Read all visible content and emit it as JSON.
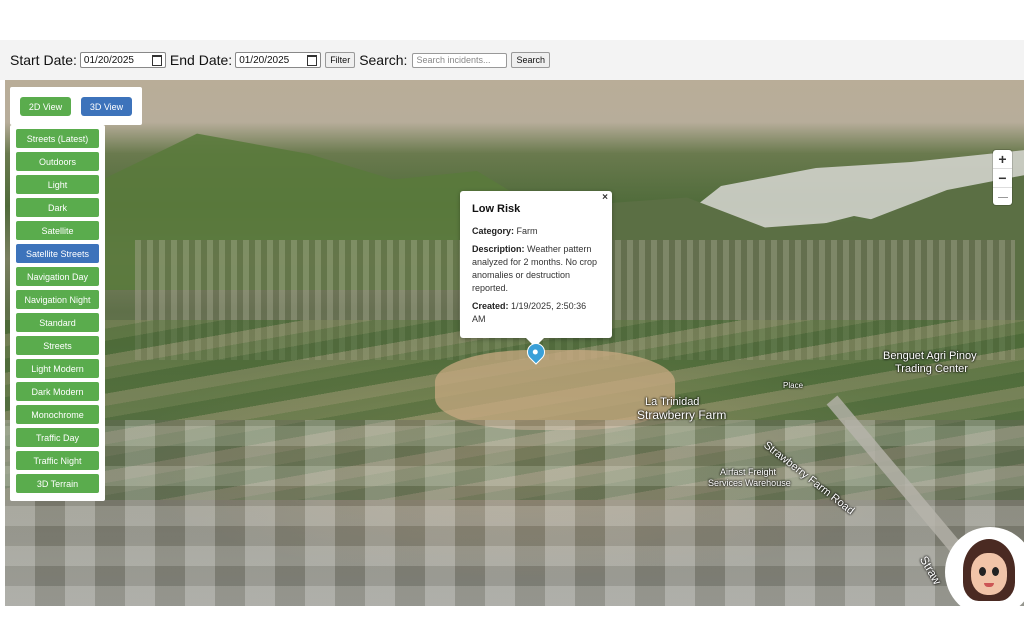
{
  "filters": {
    "start_date_label": "Start Date:",
    "start_date_value": "01/20/2025",
    "end_date_label": "End Date:",
    "end_date_value": "01/20/2025",
    "filter_button": "Filter",
    "search_label": "Search:",
    "search_placeholder": "Search incidents...",
    "search_button": "Search"
  },
  "views": {
    "btn_2d": "2D View",
    "btn_3d": "3D View",
    "colors": {
      "green": "#5aac4d",
      "blue": "#3d73bb"
    }
  },
  "map_styles": [
    "Streets (Latest)",
    "Outdoors",
    "Light",
    "Dark",
    "Satellite",
    "Satellite Streets",
    "Navigation Day",
    "Navigation Night",
    "Standard",
    "Streets",
    "Light Modern",
    "Dark Modern",
    "Monochrome",
    "Traffic Day",
    "Traffic Night",
    "3D Terrain"
  ],
  "active_style": "Satellite Streets",
  "zoom": {
    "in": "+",
    "out": "−"
  },
  "popup": {
    "close": "×",
    "title": "Low Risk",
    "category_label": "Category:",
    "category_value": "Farm",
    "description_label": "Description:",
    "description_value": "Weather pattern analyzed for 2 months. No crop anomalies or destruction reported.",
    "created_label": "Created:",
    "created_value": "1/19/2025, 2:50:36 AM"
  },
  "map_labels": {
    "la_trinidad": "La Trinidad",
    "strawberry_farm": "Strawberry Farm",
    "benguet_agri_1": "Benguet Agri Pinoy",
    "benguet_agri_2": "Trading Center",
    "strawberry_road": "Strawberry Farm Road",
    "freight_1": "Airfast Freight",
    "freight_2": "Services Warehouse",
    "place": "Place",
    "stray": "Straw"
  }
}
